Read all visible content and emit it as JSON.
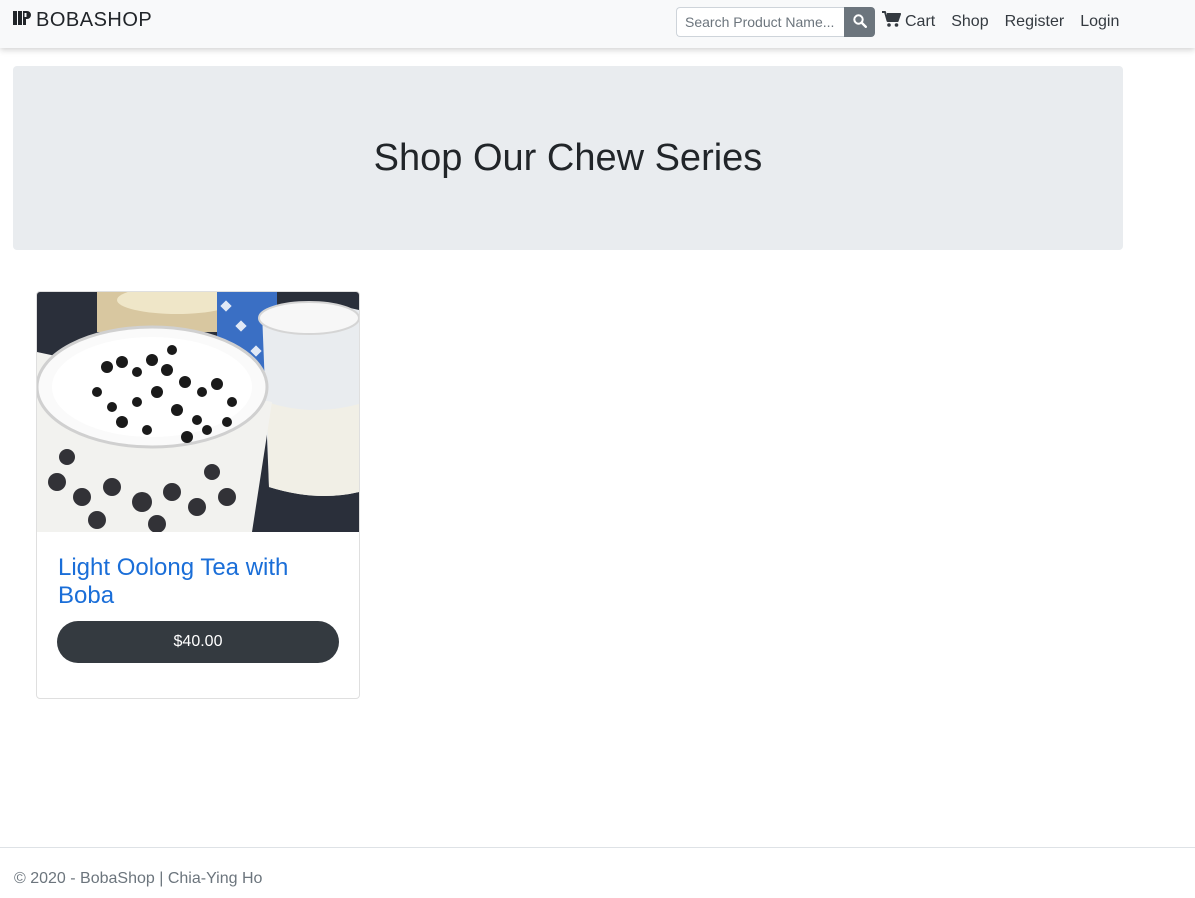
{
  "navbar": {
    "brand": "BOBASHOP",
    "search_placeholder": "Search Product Name...",
    "links": {
      "cart": "Cart",
      "shop": "Shop",
      "register": "Register",
      "login": "Login"
    }
  },
  "hero": {
    "title": "Shop Our Chew Series"
  },
  "products": [
    {
      "name": "Light Oolong Tea with Boba",
      "price": "$40.00"
    }
  ],
  "footer": {
    "text": "© 2020 - BobaShop | Chia-Ying Ho"
  },
  "colors": {
    "navbar_bg": "#f8f9fa",
    "hero_bg": "#e9ecef",
    "product_title": "#1a6ed8",
    "price_button": "#343a40",
    "search_button": "#6c757d"
  }
}
